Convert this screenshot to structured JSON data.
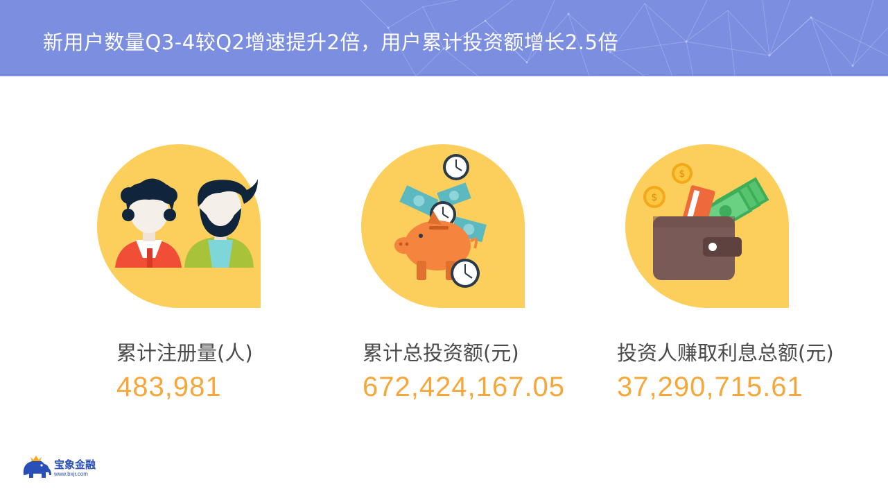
{
  "header": {
    "title": "新用户数量Q3-4较Q2增速提升2倍，用户累计投资额增长2.5倍",
    "background_color": "#7b8ee0"
  },
  "stats": [
    {
      "label": "累计注册量(人)",
      "value": "483,981",
      "icon": "users-icon"
    },
    {
      "label": "累计总投资额(元)",
      "value": "672,424,167.05",
      "icon": "piggy-bank-icon"
    },
    {
      "label": "投资人赚取利息总额(元)",
      "value": "37,290,715.61",
      "icon": "wallet-icon"
    }
  ],
  "colors": {
    "accent_yellow": "#fccf5c",
    "value_orange": "#f7a73a",
    "label_gray": "#4a4a4a"
  },
  "logo": {
    "name": "宝象金融",
    "url": "www.bxjr.com",
    "icon": "elephant-logo-icon"
  }
}
